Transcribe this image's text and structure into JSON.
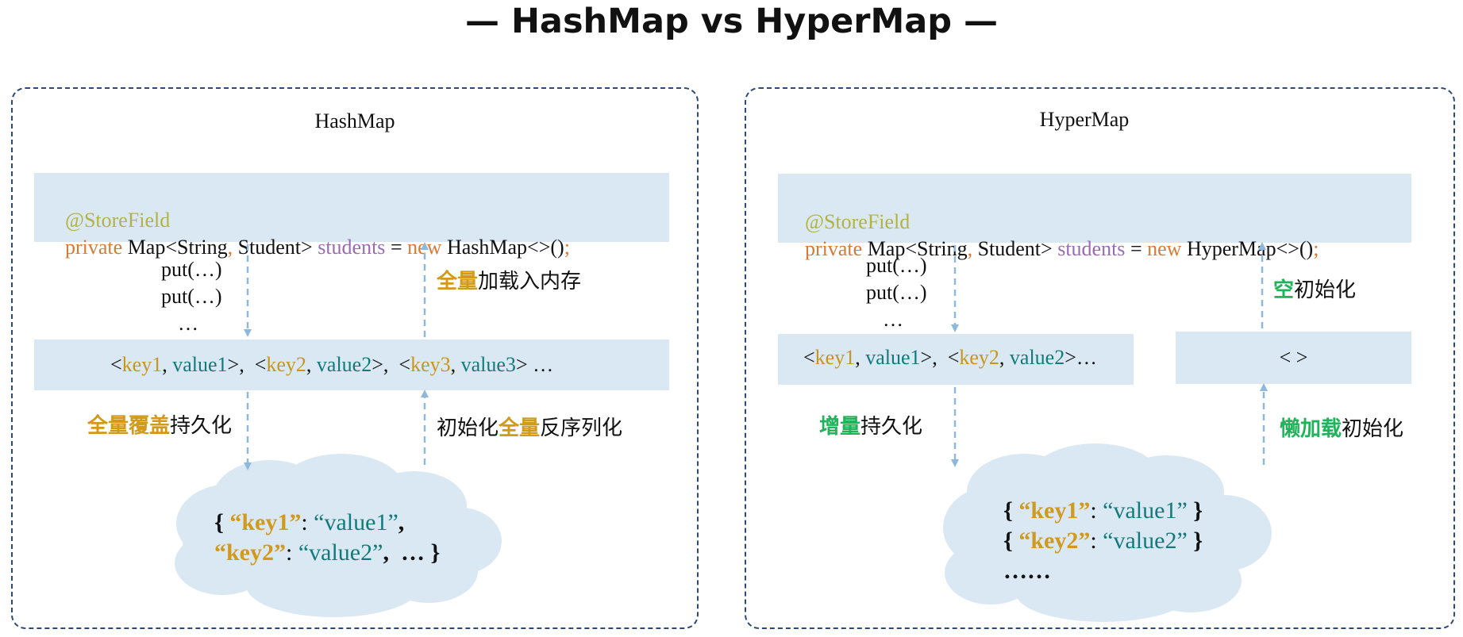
{
  "title": "— HashMap vs HyperMap —",
  "left": {
    "heading": "HashMap",
    "annotation": "@StoreField",
    "decl": {
      "kw": "private",
      "type_a": " Map<String",
      "comma": ",",
      "type_b": " Student> ",
      "field": "students",
      "eq": " = ",
      "new_kw": "new",
      "ctor": " HashMap<>()",
      "semi": ";"
    },
    "puts": [
      "put(…)",
      "put(…)",
      "…"
    ],
    "entries": [
      {
        "lt": "<",
        "key": "key1",
        "sep": ", ",
        "val": "value1",
        "gt": ">,  "
      },
      {
        "lt": "<",
        "key": "key2",
        "sep": ", ",
        "val": "value2",
        "gt": ">,  "
      },
      {
        "lt": "<",
        "key": "key3",
        "sep": ", ",
        "val": "value3",
        "gt": "> …"
      }
    ],
    "load_label": {
      "hl": "全量",
      "rest": "加载入内存"
    },
    "persist_label": {
      "hl": "全量覆盖",
      "rest": "持久化"
    },
    "deser_label": {
      "pre": "初始化",
      "hl": "全量",
      "rest": "反序列化"
    },
    "cloud": {
      "l1_open": "{ ",
      "l1_key": "“key1”",
      "l1_colon": ": ",
      "l1_val": "“value1”",
      "l1_end": ",",
      "l2_key": "“key2”",
      "l2_colon": ": ",
      "l2_val": "“value2”",
      "l2_end": ",  … }"
    }
  },
  "right": {
    "heading": "HyperMap",
    "annotation": "@StoreField",
    "decl": {
      "kw": "private",
      "type_a": " Map<String",
      "comma": ",",
      "type_b": " Student> ",
      "field": "students",
      "eq": " = ",
      "new_kw": "new",
      "ctor": " HyperMap<>()",
      "semi": ";"
    },
    "puts": [
      "put(…)",
      "put(…)",
      "…"
    ],
    "entries": [
      {
        "lt": "<",
        "key": "key1",
        "sep": ", ",
        "val": "value1",
        "gt": ">,  "
      },
      {
        "lt": "<",
        "key": "key2",
        "sep": ", ",
        "val": "value2",
        "gt": ">…"
      }
    ],
    "empty_box": "< >",
    "empty_init_label": {
      "hl": "空",
      "rest": "初始化"
    },
    "incr_label": {
      "hl": "增量",
      "rest": "持久化"
    },
    "lazy_label": {
      "hl": "懒加载",
      "rest": "初始化"
    },
    "cloud": {
      "l1_open": "{ ",
      "l1_key": "“key1”",
      "l1_colon": ": ",
      "l1_val": "“value1”",
      "l1_end": " }",
      "l2_open": "{ ",
      "l2_key": "“key2”",
      "l2_colon": ": ",
      "l2_val": "“value2”",
      "l2_end": " }",
      "l3": "……"
    }
  },
  "colors": {
    "border": "#2b4a78",
    "bar": "#dae8f4",
    "cloud": "#dae8f4",
    "arrow": "#8fb9dc",
    "annotation": "#b3b340",
    "keyword": "#d67a35",
    "field": "#9a6bb0",
    "key": "#c9961a",
    "value": "#127a7a",
    "gold": "#d19a1a",
    "green": "#1fb35a"
  }
}
